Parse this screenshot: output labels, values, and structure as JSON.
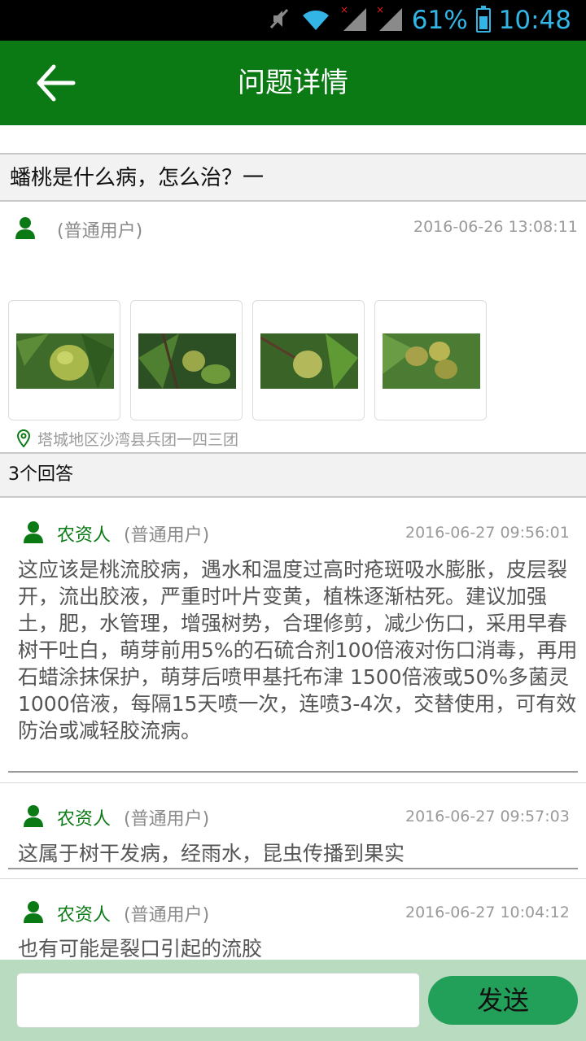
{
  "status": {
    "battery": "61%",
    "time": "10:48"
  },
  "header": {
    "title": "问题详情"
  },
  "question": {
    "title": "蟠桃是什么病，怎么治？一",
    "role": "(普通用户)",
    "time": "2016-06-26 13:08:11",
    "location": "塔城地区沙湾县兵团一四三团"
  },
  "answers_header": {
    "count_label": "3个回答"
  },
  "answers": [
    {
      "name": "农资人",
      "role": "(普通用户)",
      "time": "2016-06-27 09:56:01",
      "text": "这应该是桃流胶病，遇水和温度过高时疮斑吸水膨胀，皮层裂开，流出胶液，严重时叶片变黄，植株逐渐枯死。建议加强土，肥，水管理，增强树势，合理修剪，减少伤口，采用早春树干吐白，萌芽前用5%的石硫合剂100倍液对伤口消毒，再用石蜡涂抹保护，萌芽后喷甲基托布津 1500倍液或50%多菌灵1000倍液，每隔15天喷一次，连喷3-4次，交替使用，可有效防治或减轻胶流病。"
    },
    {
      "name": "农资人",
      "role": "(普通用户)",
      "time": "2016-06-27 09:57:03",
      "text": "这属于树干发病，经雨水，昆虫传播到果实"
    },
    {
      "name": "农资人",
      "role": "(普通用户)",
      "time": "2016-06-27 10:04:12",
      "text": "也有可能是裂口引起的流胶"
    }
  ],
  "reply": {
    "placeholder": "",
    "send_label": "发送"
  },
  "colors": {
    "primary": "#0b7a15",
    "send": "#22a05a",
    "bottom_bar": "#b9dbc0"
  }
}
